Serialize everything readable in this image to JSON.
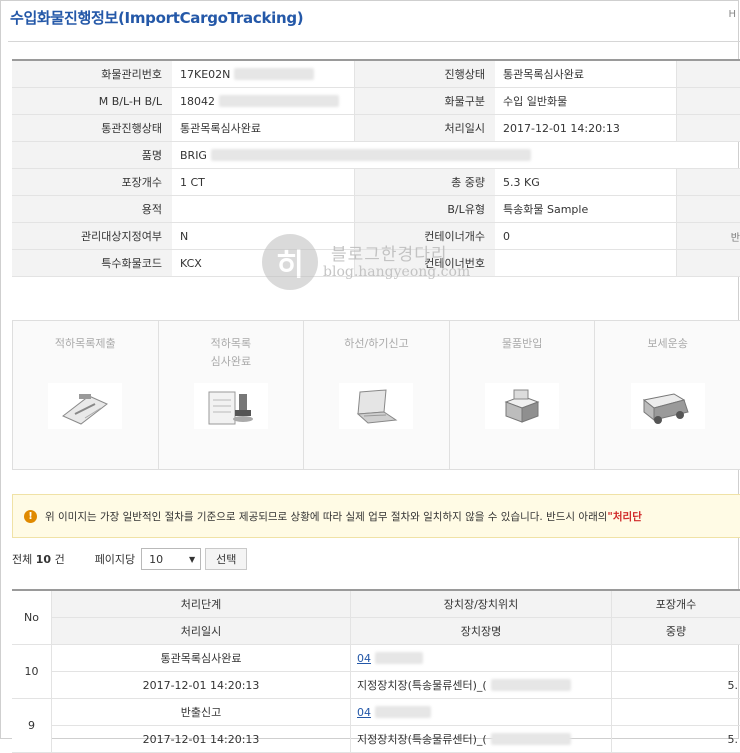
{
  "page": {
    "title": "수입화물진행정보(ImportCargoTracking)",
    "corner_mark": "H"
  },
  "info": {
    "rows": [
      {
        "label1": "화물관리번호",
        "value1": "17KE02N",
        "label2": "진행상태",
        "value2": "통관목록심사완료"
      },
      {
        "label1": "M B/L-H B/L",
        "value1": "18042",
        "label2": "화물구분",
        "value2": "수입 일반화물"
      },
      {
        "label1": "통관진행상태",
        "value1": "통관목록심사완료",
        "label2": "처리일시",
        "value2": "2017-12-01 14:20:13"
      },
      {
        "label1": "품명",
        "value1": "BRIG"
      },
      {
        "label1": "포장개수",
        "value1": "1 CT",
        "label2": "총 중량",
        "value2": "5.3 KG"
      },
      {
        "label1": "용적",
        "value1": "",
        "label2": "B/L유형",
        "value2": "특송화물 Sample"
      },
      {
        "label1": "관리대상지정여부",
        "value1": "N",
        "label2": "컨테이너개수",
        "value2": "0"
      },
      {
        "label1": "특수화물코드",
        "value1": "KCX",
        "label2": "컨테이너번호",
        "value2": ""
      }
    ],
    "edge_char": "반"
  },
  "watermark": {
    "glyph": "히",
    "line1": "블로그한경다리",
    "line2": "blog.hangyeong.com"
  },
  "steps": [
    {
      "label": "적하목록제출",
      "icon": "clipboard-icon"
    },
    {
      "label": "적하목록\n심사완료",
      "icon": "stamp-document-icon"
    },
    {
      "label": "하선/하기신고",
      "icon": "laptop-icon"
    },
    {
      "label": "물품반입",
      "icon": "boxes-icon"
    },
    {
      "label": "보세운송",
      "icon": "truck-icon"
    }
  ],
  "notice": {
    "text": "위 이미지는 가장 일반적인 절차를 기준으로 제공되므로 상황에 따라 실제 업무 절차와 일치하지 않을 수 있습니다. 반드시 아래의 ",
    "highlight": "\"처리단",
    "colors": {
      "warning": "#e08a00",
      "highlight": "#d12b2b"
    }
  },
  "controls": {
    "total_prefix": "전체",
    "total_count": "10",
    "total_suffix": "건",
    "per_page_label": "페이지당",
    "per_page_value": "10",
    "select_button": "선택"
  },
  "list": {
    "headers": {
      "no": "No",
      "step": "처리단계",
      "date": "처리일시",
      "location": "장치장/장치위치",
      "location_name": "장치장명",
      "packages": "포장개수",
      "weight": "중량"
    },
    "rows": [
      {
        "no": "10",
        "step": "통관목록심사완료",
        "code": "04",
        "date": "2017-12-01 14:20:13",
        "location_name": "지정장치장(특송물류센터)_(",
        "weight": "5."
      },
      {
        "no": "9",
        "step": "반출신고",
        "code": "04",
        "date": "2017-12-01 14:20:13",
        "location_name": "지정장치장(특송물류센터)_(",
        "weight": "5."
      }
    ]
  }
}
